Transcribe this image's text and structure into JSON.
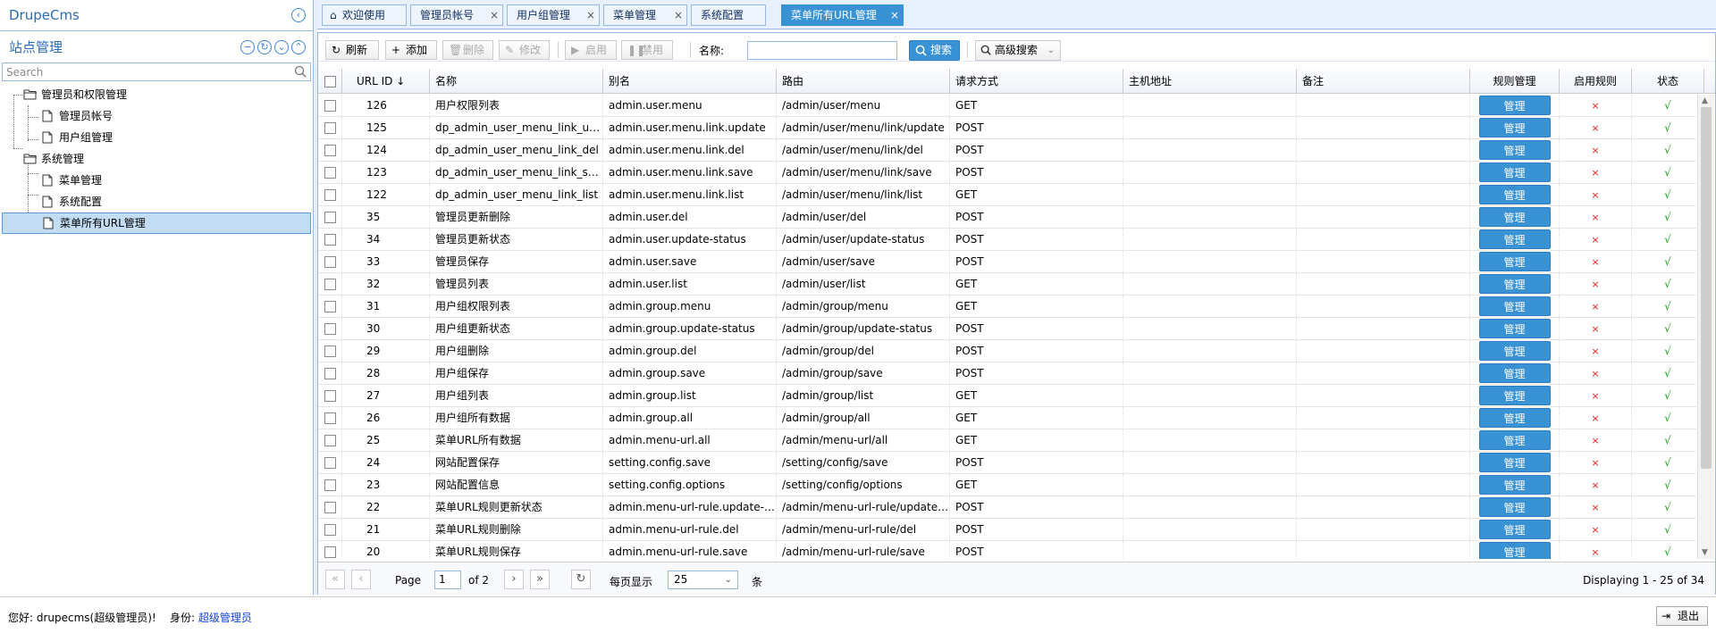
{
  "app": {
    "title": "DrupeCms"
  },
  "sidebar": {
    "title": "站点管理",
    "search_placeholder": "Search",
    "tree": [
      {
        "label": "管理员和权限管理",
        "type": "folder",
        "level": 0
      },
      {
        "label": "管理员帐号",
        "type": "file",
        "level": 1
      },
      {
        "label": "用户组管理",
        "type": "file",
        "level": 1
      },
      {
        "label": "系统管理",
        "type": "folder",
        "level": 0
      },
      {
        "label": "菜单管理",
        "type": "file",
        "level": 1
      },
      {
        "label": "系统配置",
        "type": "file",
        "level": 1
      },
      {
        "label": "菜单所有URL管理",
        "type": "file",
        "level": 1,
        "selected": true
      }
    ]
  },
  "tabs": [
    {
      "label": "欢迎使用",
      "icon": "home-icon",
      "closable": false
    },
    {
      "label": "管理员帐号",
      "closable": true
    },
    {
      "label": "用户组管理",
      "closable": true
    },
    {
      "label": "菜单管理",
      "closable": true
    },
    {
      "label": "系统配置",
      "closable": false
    },
    {
      "label": "菜单所有URL管理",
      "closable": true,
      "active": true
    }
  ],
  "tab_close": "×",
  "toolbar": {
    "refresh": "刷新",
    "add": "添加",
    "delete": "删除",
    "edit": "修改",
    "enable": "启用",
    "disable": "禁用",
    "name_label": "名称:",
    "name_value": "",
    "search": "搜索",
    "advanced": "高级搜索"
  },
  "table": {
    "columns": [
      "URL ID",
      "名称",
      "别名",
      "路由",
      "请求方式",
      "主机地址",
      "备注",
      "规则管理",
      "启用规则",
      "状态"
    ],
    "sort_indicator": "↓",
    "manage_label": "管理",
    "rule_mark": "×",
    "status_mark": "√",
    "rows": [
      [
        "126",
        "用户权限列表",
        "admin.user.menu",
        "/admin/user/menu",
        "GET",
        "",
        ""
      ],
      [
        "125",
        "dp_admin_user_menu_link_update",
        "admin.user.menu.link.update",
        "/admin/user/menu/link/update",
        "POST",
        "",
        ""
      ],
      [
        "124",
        "dp_admin_user_menu_link_del",
        "admin.user.menu.link.del",
        "/admin/user/menu/link/del",
        "POST",
        "",
        ""
      ],
      [
        "123",
        "dp_admin_user_menu_link_save",
        "admin.user.menu.link.save",
        "/admin/user/menu/link/save",
        "POST",
        "",
        ""
      ],
      [
        "122",
        "dp_admin_user_menu_link_list",
        "admin.user.menu.link.list",
        "/admin/user/menu/link/list",
        "GET",
        "",
        ""
      ],
      [
        "35",
        "管理员更新删除",
        "admin.user.del",
        "/admin/user/del",
        "POST",
        "",
        ""
      ],
      [
        "34",
        "管理员更新状态",
        "admin.user.update-status",
        "/admin/user/update-status",
        "POST",
        "",
        ""
      ],
      [
        "33",
        "管理员保存",
        "admin.user.save",
        "/admin/user/save",
        "POST",
        "",
        ""
      ],
      [
        "32",
        "管理员列表",
        "admin.user.list",
        "/admin/user/list",
        "GET",
        "",
        ""
      ],
      [
        "31",
        "用户组权限列表",
        "admin.group.menu",
        "/admin/group/menu",
        "GET",
        "",
        ""
      ],
      [
        "30",
        "用户组更新状态",
        "admin.group.update-status",
        "/admin/group/update-status",
        "POST",
        "",
        ""
      ],
      [
        "29",
        "用户组删除",
        "admin.group.del",
        "/admin/group/del",
        "POST",
        "",
        ""
      ],
      [
        "28",
        "用户组保存",
        "admin.group.save",
        "/admin/group/save",
        "POST",
        "",
        ""
      ],
      [
        "27",
        "用户组列表",
        "admin.group.list",
        "/admin/group/list",
        "GET",
        "",
        ""
      ],
      [
        "26",
        "用户组所有数据",
        "admin.group.all",
        "/admin/group/all",
        "GET",
        "",
        ""
      ],
      [
        "25",
        "菜单URL所有数据",
        "admin.menu-url.all",
        "/admin/menu-url/all",
        "GET",
        "",
        ""
      ],
      [
        "24",
        "网站配置保存",
        "setting.config.save",
        "/setting/config/save",
        "POST",
        "",
        ""
      ],
      [
        "23",
        "网站配置信息",
        "setting.config.options",
        "/setting/config/options",
        "GET",
        "",
        ""
      ],
      [
        "22",
        "菜单URL规则更新状态",
        "admin.menu-url-rule.update-status",
        "/admin/menu-url-rule/update-status",
        "POST",
        "",
        ""
      ],
      [
        "21",
        "菜单URL规则删除",
        "admin.menu-url-rule.del",
        "/admin/menu-url-rule/del",
        "POST",
        "",
        ""
      ],
      [
        "20",
        "菜单URL规则保存",
        "admin.menu-url-rule.save",
        "/admin/menu-url-rule/save",
        "POST",
        "",
        ""
      ]
    ]
  },
  "pager": {
    "page_label": "Page",
    "page_value": "1",
    "of_label": "of 2",
    "per_page_label": "每页显示",
    "per_page_value": "25",
    "per_page_unit": "条",
    "display_text": "Displaying 1 - 25 of 34"
  },
  "footer": {
    "greeting": "您好: drupecms(超级管理员)!",
    "identity_label": "身份:",
    "identity_value": "超级管理员",
    "logout": "退出"
  },
  "colors": {
    "accent": "#3892d4",
    "border": "#95b8e7",
    "cross": "#e02020",
    "check": "#21a121"
  }
}
